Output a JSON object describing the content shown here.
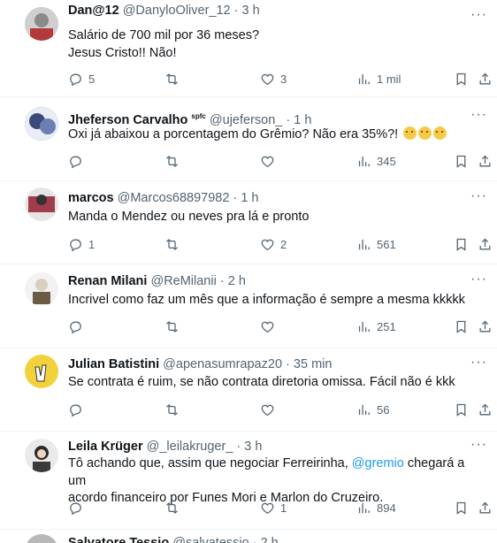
{
  "tweets": [
    {
      "name": "Dan@12",
      "handle": "@DanyloOliver_12",
      "time": "3 h",
      "lines": [
        "Salário de 700 mil por 36 meses?",
        "Jesus Cristo!! Não!"
      ],
      "replies": "5",
      "retweets": "",
      "likes": "3",
      "views": "1 mil",
      "avatar_color": "#c9c9c9"
    },
    {
      "name": "Jheferson Carvalho",
      "badge": "spfc",
      "handle": "@ujeferson_",
      "time": "1 h",
      "lines": [
        "Oxi já abaixou a porcentagem do Grêmio? Não era 35%?!"
      ],
      "replies": "",
      "retweets": "",
      "likes": "",
      "views": "345",
      "avatar_color": "#3c4a7a"
    },
    {
      "name": "marcos",
      "handle": "@Marcos68897982",
      "time": "1 h",
      "lines": [
        "Manda o Mendez ou neves pra lá e pronto"
      ],
      "replies": "1",
      "retweets": "",
      "likes": "2",
      "views": "561",
      "avatar_color": "#a23b4a"
    },
    {
      "name": "Renan Milani",
      "handle": "@ReMilanii",
      "time": "2 h",
      "lines": [
        "Incrivel como faz um mês que a informação é sempre a mesma kkkkk"
      ],
      "replies": "",
      "retweets": "",
      "likes": "",
      "views": "251",
      "avatar_color": "#d8cfc0"
    },
    {
      "name": "Julian Batistini",
      "handle": "@apenasumrapaz20",
      "time": "35 min",
      "lines": [
        "Se contrata é ruim, se não contrata diretoria omissa. Fácil não é kkk"
      ],
      "replies": "",
      "retweets": "",
      "likes": "",
      "views": "56",
      "avatar_color": "#f2d23c"
    },
    {
      "name": "Leila Krüger",
      "handle": "@_leilakruger_",
      "time": "3 h",
      "line1_pre": "Tô achando que, assim que negociar Ferreirinha, ",
      "mention": "@gremio",
      "line1_post": " chegará a um",
      "line2": "acordo financeiro por Funes Mori e Marlon do Cruzeiro.",
      "replies": "",
      "retweets": "",
      "likes": "1",
      "views": "894",
      "avatar_color": "#e4e4e4"
    },
    {
      "name": "Salvatore Tessio",
      "handle": "@salvatessio",
      "time": "2 h",
      "avatar_color": "#b8b8b8"
    }
  ],
  "icons": {
    "reply": "reply-icon",
    "retweet": "retweet-icon",
    "like": "like-icon",
    "views": "views-icon",
    "bookmark": "bookmark-icon",
    "share": "share-icon",
    "more": "more-icon"
  },
  "dot": "·",
  "more_glyph": "···"
}
